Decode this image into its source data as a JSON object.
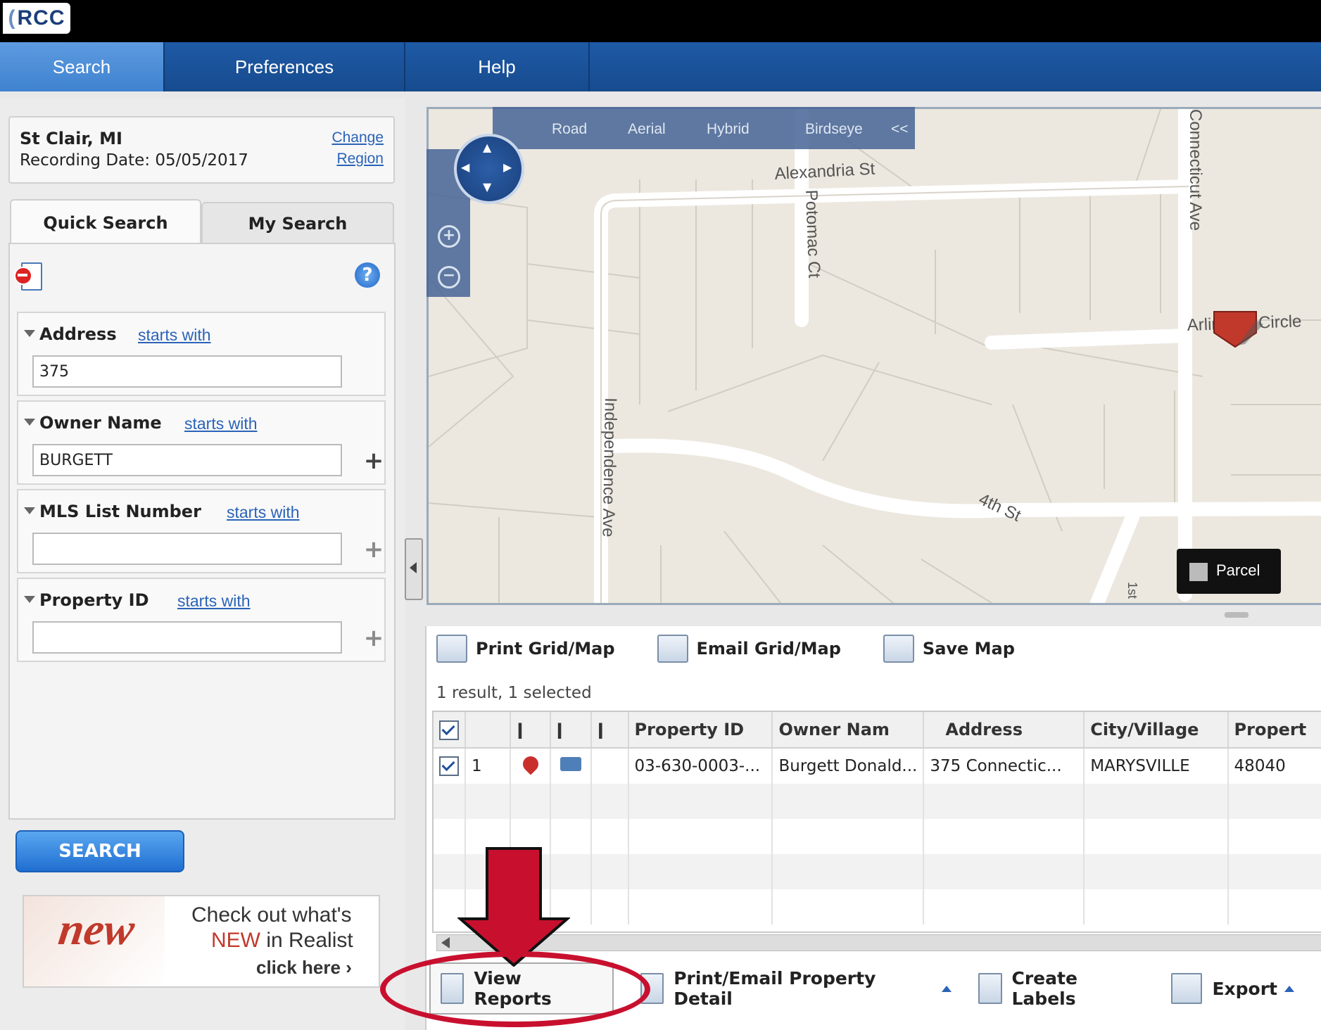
{
  "app": {
    "logo_text": "RCC"
  },
  "nav": {
    "tabs": [
      {
        "label": "Search"
      },
      {
        "label": "Preferences"
      },
      {
        "label": "Help"
      }
    ]
  },
  "region": {
    "name": "St Clair, MI",
    "recording_date": "Recording Date: 05/05/2017",
    "change_line1": "Change",
    "change_line2": "Region"
  },
  "search_tabs": {
    "quick": "Quick Search",
    "my": "My Search"
  },
  "fields": [
    {
      "label": "Address",
      "mode": "starts with",
      "value": "375"
    },
    {
      "label": "Owner Name",
      "mode": "starts with",
      "value": "BURGETT"
    },
    {
      "label": "MLS List Number",
      "mode": "starts with",
      "value": ""
    },
    {
      "label": "Property ID",
      "mode": "starts with",
      "value": ""
    }
  ],
  "search_button": "SEARCH",
  "promo": {
    "badge": "new",
    "line1": "Check out what's",
    "line2_highlight": "NEW",
    "line2_rest": " in Realist",
    "line3": "click here ›"
  },
  "map": {
    "types": [
      "Road",
      "Aerial",
      "Hybrid",
      "Birdseye",
      "<<"
    ],
    "streets": [
      "Alexandria St",
      "Potomac Ct",
      "Connecticut Ave",
      "Arlington Circle",
      "Independence Ave",
      "4th St",
      "1st"
    ],
    "parcel_label": "Parcel"
  },
  "toolbar": {
    "print": "Print Grid/Map",
    "email": "Email Grid/Map",
    "save": "Save Map"
  },
  "grid": {
    "result_text": "1 result, 1 selected",
    "headers": [
      "Property ID",
      "Owner Nam",
      "Address",
      "City/Village",
      "Propert"
    ],
    "rows": [
      {
        "num": "1",
        "property_id": "03-630-0003-...",
        "owner": "Burgett Donald...",
        "address": "375 Connectic...",
        "city": "MARYSVILLE",
        "zip": "48040"
      }
    ]
  },
  "actions": {
    "view_reports": "View Reports",
    "print_email": "Print/Email Property Detail",
    "labels": "Create Labels",
    "export": "Export"
  },
  "colors": {
    "nav": "#1e5aa6",
    "active_tab": "#5d9be0",
    "callout": "#c8102e",
    "link": "#2a63b8"
  }
}
